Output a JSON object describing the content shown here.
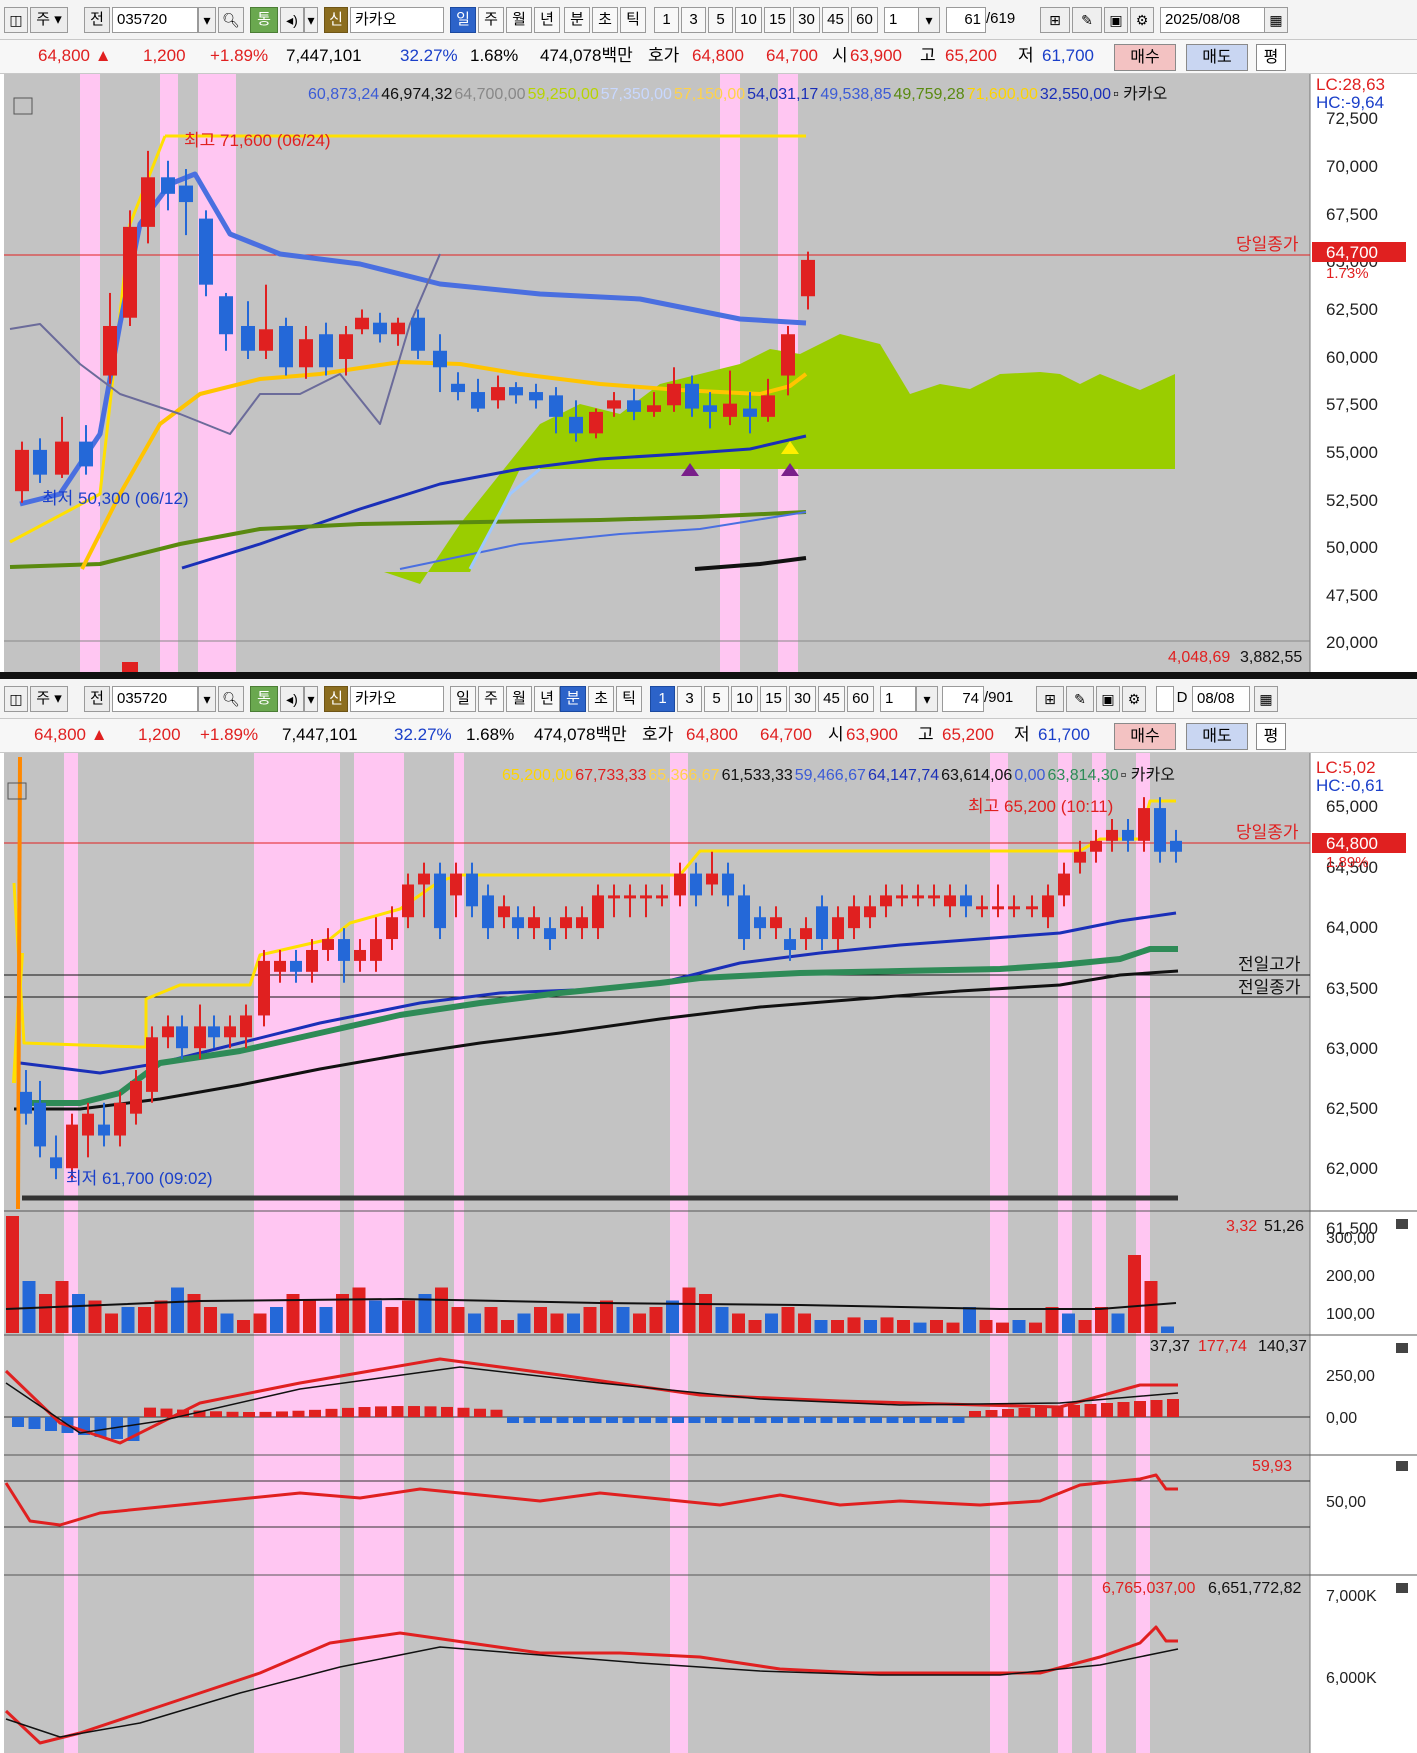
{
  "top": {
    "toolbar": {
      "market": "주",
      "mode": "전",
      "code": "035720",
      "tong": "통",
      "sin": "신",
      "stock": "카카오",
      "periods": [
        "일",
        "주",
        "월",
        "년",
        "분",
        "초",
        "틱"
      ],
      "intervals": [
        "1",
        "3",
        "5",
        "10",
        "15",
        "30",
        "45",
        "60"
      ],
      "interval_value": "1",
      "count": "61",
      "total": "/619",
      "date": "2025/08/08"
    },
    "quote": {
      "price": "64,800",
      "change": "1,200",
      "change_pct": "+1.89%",
      "volume": "7,447,101",
      "v1": "32.27%",
      "v2": "1.68%",
      "amount": "474,078백만",
      "hoga_label": "호가",
      "ask": "64,800",
      "bid": "64,700",
      "open_label": "시",
      "open": "63,900",
      "high_label": "고",
      "high": "65,200",
      "low_label": "저",
      "low": "61,700",
      "buy": "매수",
      "sell": "매도",
      "avg": "평"
    },
    "legend": [
      {
        "text": "60,873,24",
        "color": "#3b5bd6"
      },
      {
        "text": "46,974,32",
        "color": "#111111"
      },
      {
        "text": "64,700,00",
        "color": "#888888"
      },
      {
        "text": "59,250,00",
        "color": "#b8d400"
      },
      {
        "text": "57,350,00",
        "color": "#c8d8ff"
      },
      {
        "text": "57,150,00",
        "color": "#ffd24a"
      },
      {
        "text": "54,031,17",
        "color": "#1a2fb8"
      },
      {
        "text": "49,538,85",
        "color": "#3b5bd6"
      },
      {
        "text": "49,759,28",
        "color": "#5a8a10"
      },
      {
        "text": "71,600,00",
        "color": "#ffd400"
      },
      {
        "text": "32,550,00",
        "color": "#1a2fb8"
      },
      {
        "text": "카카오",
        "color": "#111111"
      }
    ],
    "lc": "LC:28,63",
    "hc": "HC:-9,64",
    "y_ticks": [
      "72,500",
      "70,000",
      "67,500",
      "65,000",
      "62,500",
      "60,000",
      "57,500",
      "55,000",
      "52,500",
      "50,000",
      "47,500",
      "20,000"
    ],
    "prev_close_label": "당일종가",
    "price_tag": "64,700",
    "price_tag_pct": "1.73%",
    "high_annotation": "최고 71,600 (06/24)",
    "low_annotation": "최저 50,300 (06/12)",
    "volume_legend": [
      "4,048,69",
      "3,882,55"
    ]
  },
  "bottom": {
    "toolbar": {
      "market": "주",
      "mode": "전",
      "code": "035720",
      "tong": "통",
      "sin": "신",
      "stock": "카카오",
      "periods": [
        "일",
        "주",
        "월",
        "년",
        "분",
        "초",
        "틱"
      ],
      "intervals": [
        "1",
        "3",
        "5",
        "10",
        "15",
        "30",
        "45",
        "60"
      ],
      "interval_value": "1",
      "count": "74",
      "total": "/901",
      "d_label": "D",
      "date": "08/08"
    },
    "quote": {
      "price": "64,800",
      "change": "1,200",
      "change_pct": "+1.89%",
      "volume": "7,447,101",
      "v1": "32.27%",
      "v2": "1.68%",
      "amount": "474,078백만",
      "hoga_label": "호가",
      "ask": "64,800",
      "bid": "64,700",
      "open_label": "시",
      "open": "63,900",
      "high_label": "고",
      "high": "65,200",
      "low_label": "저",
      "low": "61,700",
      "buy": "매수",
      "sell": "매도",
      "avg": "평"
    },
    "legend": [
      {
        "text": "65,200,00",
        "color": "#ffd400"
      },
      {
        "text": "67,733,33",
        "color": "#e02020"
      },
      {
        "text": "65,366,67",
        "color": "#ffd24a"
      },
      {
        "text": "61,533,33",
        "color": "#111111"
      },
      {
        "text": "59,466,67",
        "color": "#3b5bd6"
      },
      {
        "text": "64,147,74",
        "color": "#1a2fb8"
      },
      {
        "text": "63,614,06",
        "color": "#111111"
      },
      {
        "text": "0,00",
        "color": "#3b5bd6"
      },
      {
        "text": "63,814,30",
        "color": "#2e8b57"
      },
      {
        "text": "카카오",
        "color": "#111111"
      }
    ],
    "lc": "LC:5,02",
    "hc": "HC:-0,61",
    "y_ticks": [
      "65,000",
      "64,500",
      "64,000",
      "63,500",
      "63,000",
      "62,500",
      "62,000",
      "61,500"
    ],
    "prev_close_label": "당일종가",
    "prev_high_label": "전일고가",
    "prev_close2_label": "전일종가",
    "price_tag": "64,800",
    "price_tag_pct": "1.89%",
    "high_annotation": "최고 65,200 (10:11)",
    "low_annotation": "최저 61,700 (09:02)",
    "vol_legend": [
      "3,32",
      "51,26"
    ],
    "vol_ticks": [
      "300,00",
      "200,00",
      "100,00"
    ],
    "macd_legend": [
      "37,37",
      "177,74",
      "140,37"
    ],
    "macd_ticks": [
      "250,00",
      "0,00"
    ],
    "rsi_legend": [
      "59,93"
    ],
    "rsi_ticks": [
      "50,00"
    ],
    "obv_legend": [
      "6,765,037,00",
      "6,651,772,82"
    ],
    "obv_ticks": [
      "7,000K",
      "6,000K"
    ]
  },
  "colors": {
    "up": "#e02020",
    "down": "#2468d8",
    "chart_bg": "#c3c3c3",
    "highlight": "#ffc6f2",
    "cloud": "#9acd00",
    "ma_blue": "#4a6fe0",
    "ma_orange": "#ffc400",
    "ma_green": "#5a8a10"
  }
}
